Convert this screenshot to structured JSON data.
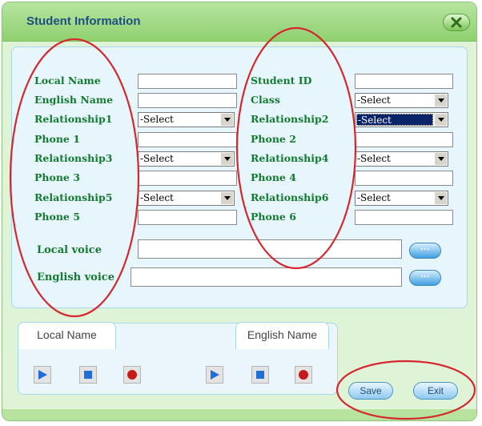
{
  "window": {
    "title": "Student Information",
    "close_icon": "close-x-icon",
    "colors": {
      "accent_green": "#8fd06f",
      "label_green": "#137a2f",
      "title_blue": "#1d4f82",
      "annotation_red": "#d6262f"
    }
  },
  "form": {
    "left": {
      "local_name": "Local Name",
      "english_name": "English Name",
      "relationship1": "Relationship1",
      "phone1": "Phone 1",
      "relationship3": "Relationship3",
      "phone3": "Phone 3",
      "relationship5": "Relationship5",
      "phone5": "Phone 5"
    },
    "right": {
      "student_id": "Student ID",
      "class": "Class",
      "relationship2": "Relationship2",
      "phone2": "Phone 2",
      "relationship4": "Relationship4",
      "phone4": "Phone 4",
      "relationship6": "Relationship6",
      "phone6": "Phone 6"
    },
    "selects": {
      "class": "-Select",
      "relationship1": "-Select",
      "relationship2": "-Select",
      "relationship3": "-Select",
      "relationship4": "-Select",
      "relationship5": "-Select",
      "relationship6": "-Select"
    },
    "voice": {
      "local_label": "Local voice",
      "english_label": "English voice",
      "browse_label": "···"
    }
  },
  "audio": {
    "local_tab": "Local Name",
    "english_tab": "English Name",
    "icons": [
      "play-icon",
      "stop-icon",
      "record-icon"
    ]
  },
  "buttons": {
    "save": "Save",
    "exit": "Exit"
  }
}
